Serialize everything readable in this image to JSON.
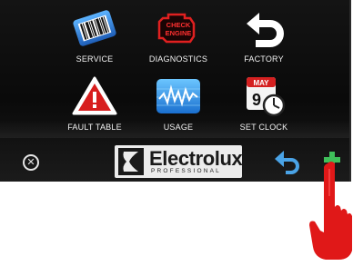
{
  "menu": {
    "items": [
      {
        "label": "SERVICE",
        "icon": "barcode-icon"
      },
      {
        "label": "DIAGNOSTICS",
        "icon": "check-engine-icon",
        "icon_text": "CHECK ENGINE"
      },
      {
        "label": "FACTORY",
        "icon": "undo-arrow-icon"
      },
      {
        "label": "FAULT TABLE",
        "icon": "warning-icon"
      },
      {
        "label": "USAGE",
        "icon": "usage-graph-icon"
      },
      {
        "label": "SET CLOCK",
        "icon": "calendar-clock-icon",
        "icon_text": "MAY",
        "icon_date": "9"
      }
    ]
  },
  "footer": {
    "brand": "Electrolux",
    "brand_sub": "PROFESSIONAL",
    "close_icon": "close-circle-icon",
    "back_icon": "back-arrow-icon",
    "add_icon": "plus-icon"
  },
  "colors": {
    "background": "#0d0d0d",
    "label": "#f2f2f2",
    "blue": "#2e7fd6",
    "red": "#e02020",
    "plus": "#3fbf5a",
    "hand": "#e01818"
  }
}
